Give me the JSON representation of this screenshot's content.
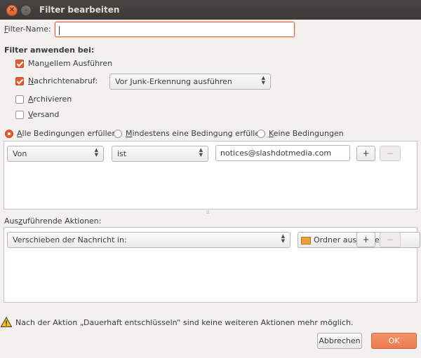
{
  "window": {
    "title": "Filter bearbeiten",
    "close_glyph": "✕",
    "min_glyph": "–"
  },
  "filter_name": {
    "label_pre": "",
    "label_u": "F",
    "label_post": "ilter-Name:",
    "value": ""
  },
  "apply": {
    "heading": "Filter anwenden bei:",
    "manual": {
      "pre": "Man",
      "u": "u",
      "post": "ellem Ausführen",
      "checked": true
    },
    "retrieval": {
      "pre": "",
      "u": "N",
      "post": "achrichtenabruf:",
      "checked": true,
      "option": "Vor Junk-Erkennung ausführen"
    },
    "archive": {
      "pre": "",
      "u": "A",
      "post": "rchivieren",
      "checked": false
    },
    "send": {
      "pre": "",
      "u": "V",
      "post": "ersand",
      "checked": false
    }
  },
  "match": {
    "all": {
      "pre": "",
      "u": "A",
      "post": "lle Bedingungen erfüllen",
      "selected": true
    },
    "any": {
      "pre": "",
      "u": "M",
      "post": "indestens eine Bedingung erfüllen",
      "selected": false
    },
    "none": {
      "pre": "",
      "u": "K",
      "post": "eine Bedingungen",
      "selected": false
    }
  },
  "condition": {
    "field": "Von",
    "operator": "ist",
    "value": "notices@slashdotmedia.com",
    "add": "+",
    "remove": "−"
  },
  "splitter": "⁞⁞",
  "actions": {
    "label_pre": "Aus",
    "label_u": "z",
    "label_post": "uführende Aktionen:",
    "action": "Verschieben der Nachricht in:",
    "folder": "Ordner auswählen...",
    "add": "+",
    "remove": "−"
  },
  "warning": {
    "text": "Nach der Aktion „Dauerhaft entschlüsseln“ sind keine weiteren Aktionen mehr möglich.",
    "icon": "warning-icon"
  },
  "buttons": {
    "cancel": "Abbrechen",
    "ok": "OK"
  },
  "colors": {
    "accent": "#e65d2e",
    "titlebar": "#3f3e3a",
    "background": "#f2f1f0"
  }
}
